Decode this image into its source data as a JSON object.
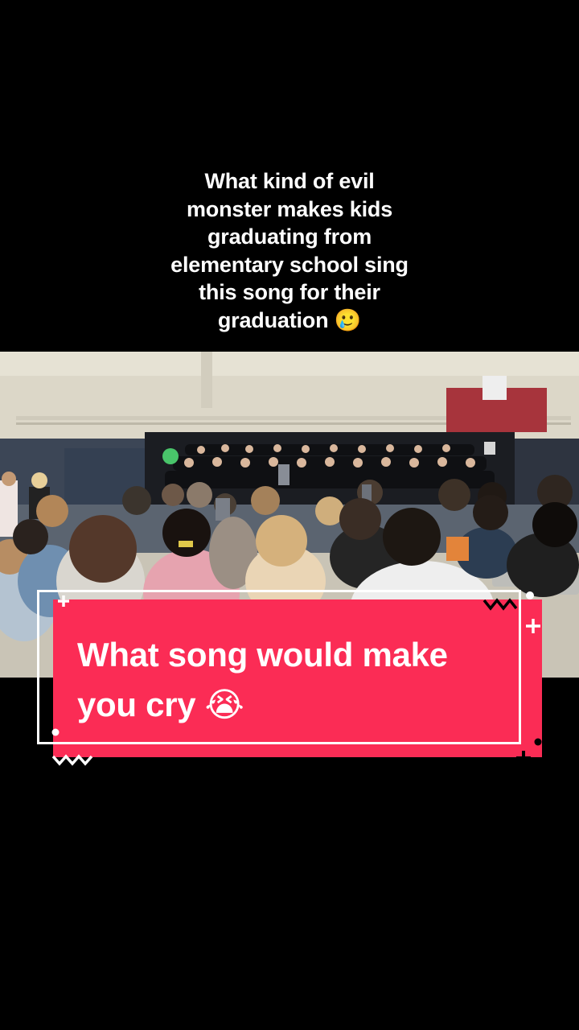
{
  "top_caption": {
    "lines": [
      "What kind of evil",
      "monster makes kids",
      "graduating from",
      "elementary school sing",
      "this song for their",
      "graduation 🥲"
    ]
  },
  "sticker": {
    "lines": [
      "What song would make",
      "you cry 😭"
    ],
    "background_color": "#fb2c55",
    "icons": [
      "plus-icon",
      "zigzag-icon",
      "dot-icon"
    ]
  },
  "video": {
    "scene": "graduation-ceremony-photo"
  }
}
